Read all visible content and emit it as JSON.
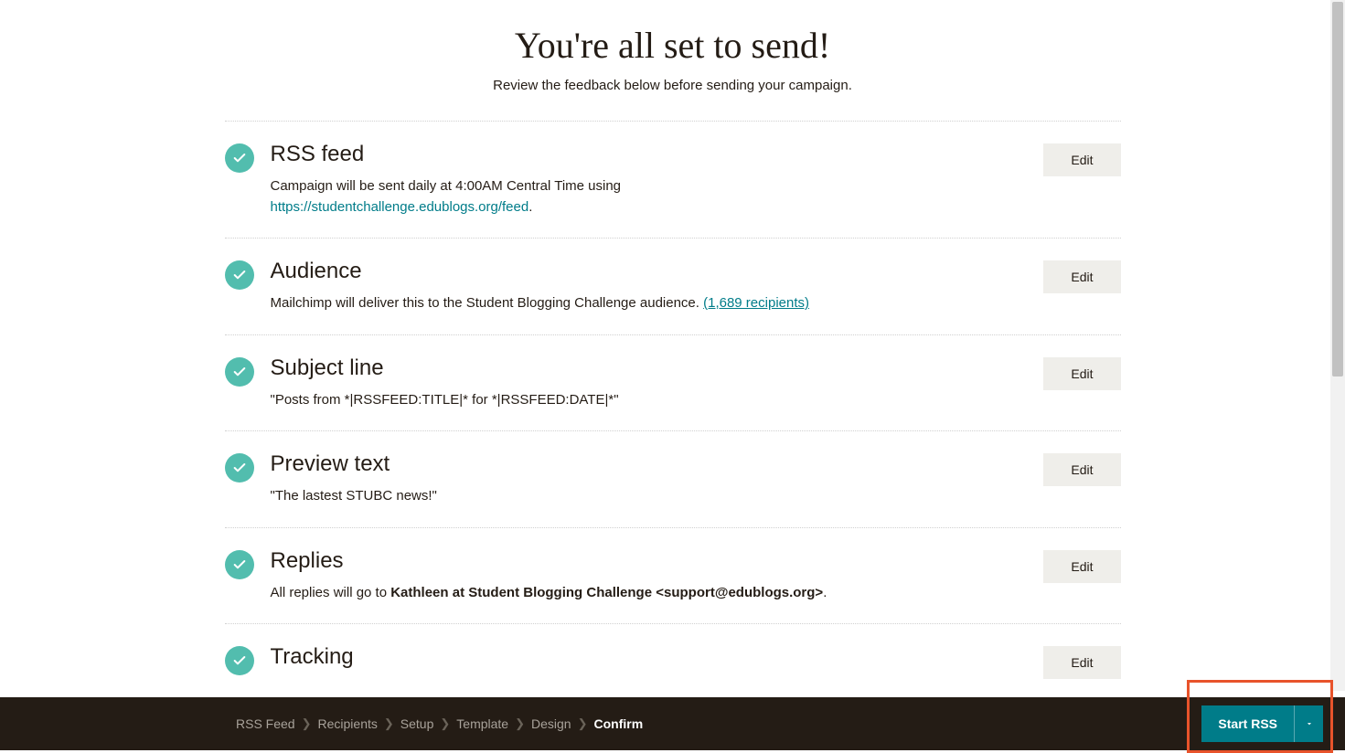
{
  "header": {
    "title": "You're all set to send!",
    "subtitle": "Review the feedback below before sending your campaign."
  },
  "sections": {
    "rss": {
      "title": "RSS feed",
      "desc_pre": "Campaign will be sent daily at 4:00AM Central Time using ",
      "link": "https://studentchallenge.edublogs.org/feed",
      "desc_post": ".",
      "edit": "Edit"
    },
    "audience": {
      "title": "Audience",
      "desc_pre": "Mailchimp will deliver this to the Student Blogging Challenge audience. ",
      "link": "(1,689 recipients)",
      "edit": "Edit"
    },
    "subject": {
      "title": "Subject line",
      "desc": "\"Posts from *|RSSFEED:TITLE|* for *|RSSFEED:DATE|*\"",
      "edit": "Edit"
    },
    "preview": {
      "title": "Preview text",
      "desc": "\"The lastest STUBC news!\"",
      "edit": "Edit"
    },
    "replies": {
      "title": "Replies",
      "desc_pre": "All replies will go to ",
      "bold": "Kathleen at Student Blogging Challenge <support@edublogs.org>",
      "desc_post": ".",
      "edit": "Edit"
    },
    "tracking": {
      "title": "Tracking",
      "edit": "Edit"
    }
  },
  "breadcrumbs": {
    "items": [
      "RSS Feed",
      "Recipients",
      "Setup",
      "Template",
      "Design",
      "Confirm"
    ],
    "active_index": 5
  },
  "actions": {
    "start": "Start RSS"
  }
}
